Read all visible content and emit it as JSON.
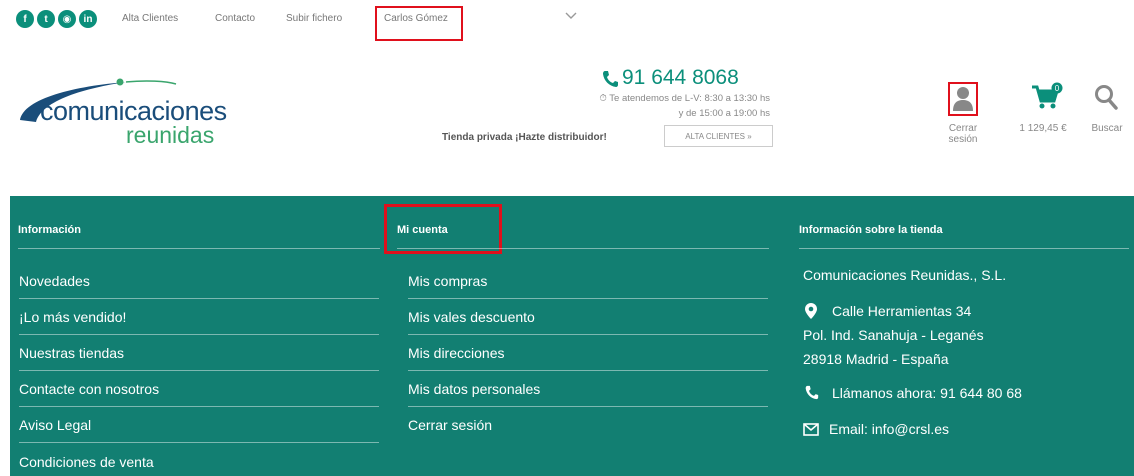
{
  "topbar": {
    "social": [
      {
        "icon": "facebook-icon",
        "glyph": "f"
      },
      {
        "icon": "twitter-icon",
        "glyph": "t"
      },
      {
        "icon": "instagram-icon",
        "glyph": "◉"
      },
      {
        "icon": "linkedin-icon",
        "glyph": "in"
      }
    ],
    "links": [
      "Alta Clientes",
      "Contacto",
      "Subir fichero"
    ],
    "user_name": "Carlos Gómez"
  },
  "header": {
    "logo_line1": "comunicaciones",
    "logo_line2": "reunidas",
    "phone": "91 644 8068",
    "hours_line1": "Te atendemos de L-V: 8:30 a 13:30 hs",
    "hours_line2": "y de 15:00 a 19:00 hs",
    "private_store": "Tienda privada ¡Hazte distribuidor!",
    "alta_button": "ALTA CLIENTES »",
    "account_label": "Cerrar sesión",
    "cart_total": "1 129,45 €",
    "cart_count": "0",
    "search_label": "Buscar"
  },
  "footer": {
    "col1": {
      "heading": "Información",
      "links": [
        "Novedades",
        "¡Lo más vendido!",
        "Nuestras tiendas",
        "Contacte con nosotros",
        "Aviso Legal",
        "Condiciones de venta"
      ]
    },
    "col2": {
      "heading": "Mi cuenta",
      "links": [
        "Mis compras",
        "Mis vales descuento",
        "Mis direcciones",
        "Mis datos personales",
        "Cerrar sesión"
      ]
    },
    "col3": {
      "heading": "Información sobre la tienda",
      "company": "Comunicaciones Reunidas., S.L.",
      "address1": "Calle Herramientas 34",
      "address2": "Pol. Ind. Sanahuja - Leganés",
      "address3": "28918 Madrid - España",
      "phone": "Llámanos ahora: 91 644 80 68",
      "email": "Email: info@crsl.es"
    }
  },
  "colors": {
    "brand_teal": "#127f72",
    "logo_blue": "#1a4d7a",
    "logo_green": "#3aa56d",
    "highlight_red": "#e0101c"
  }
}
